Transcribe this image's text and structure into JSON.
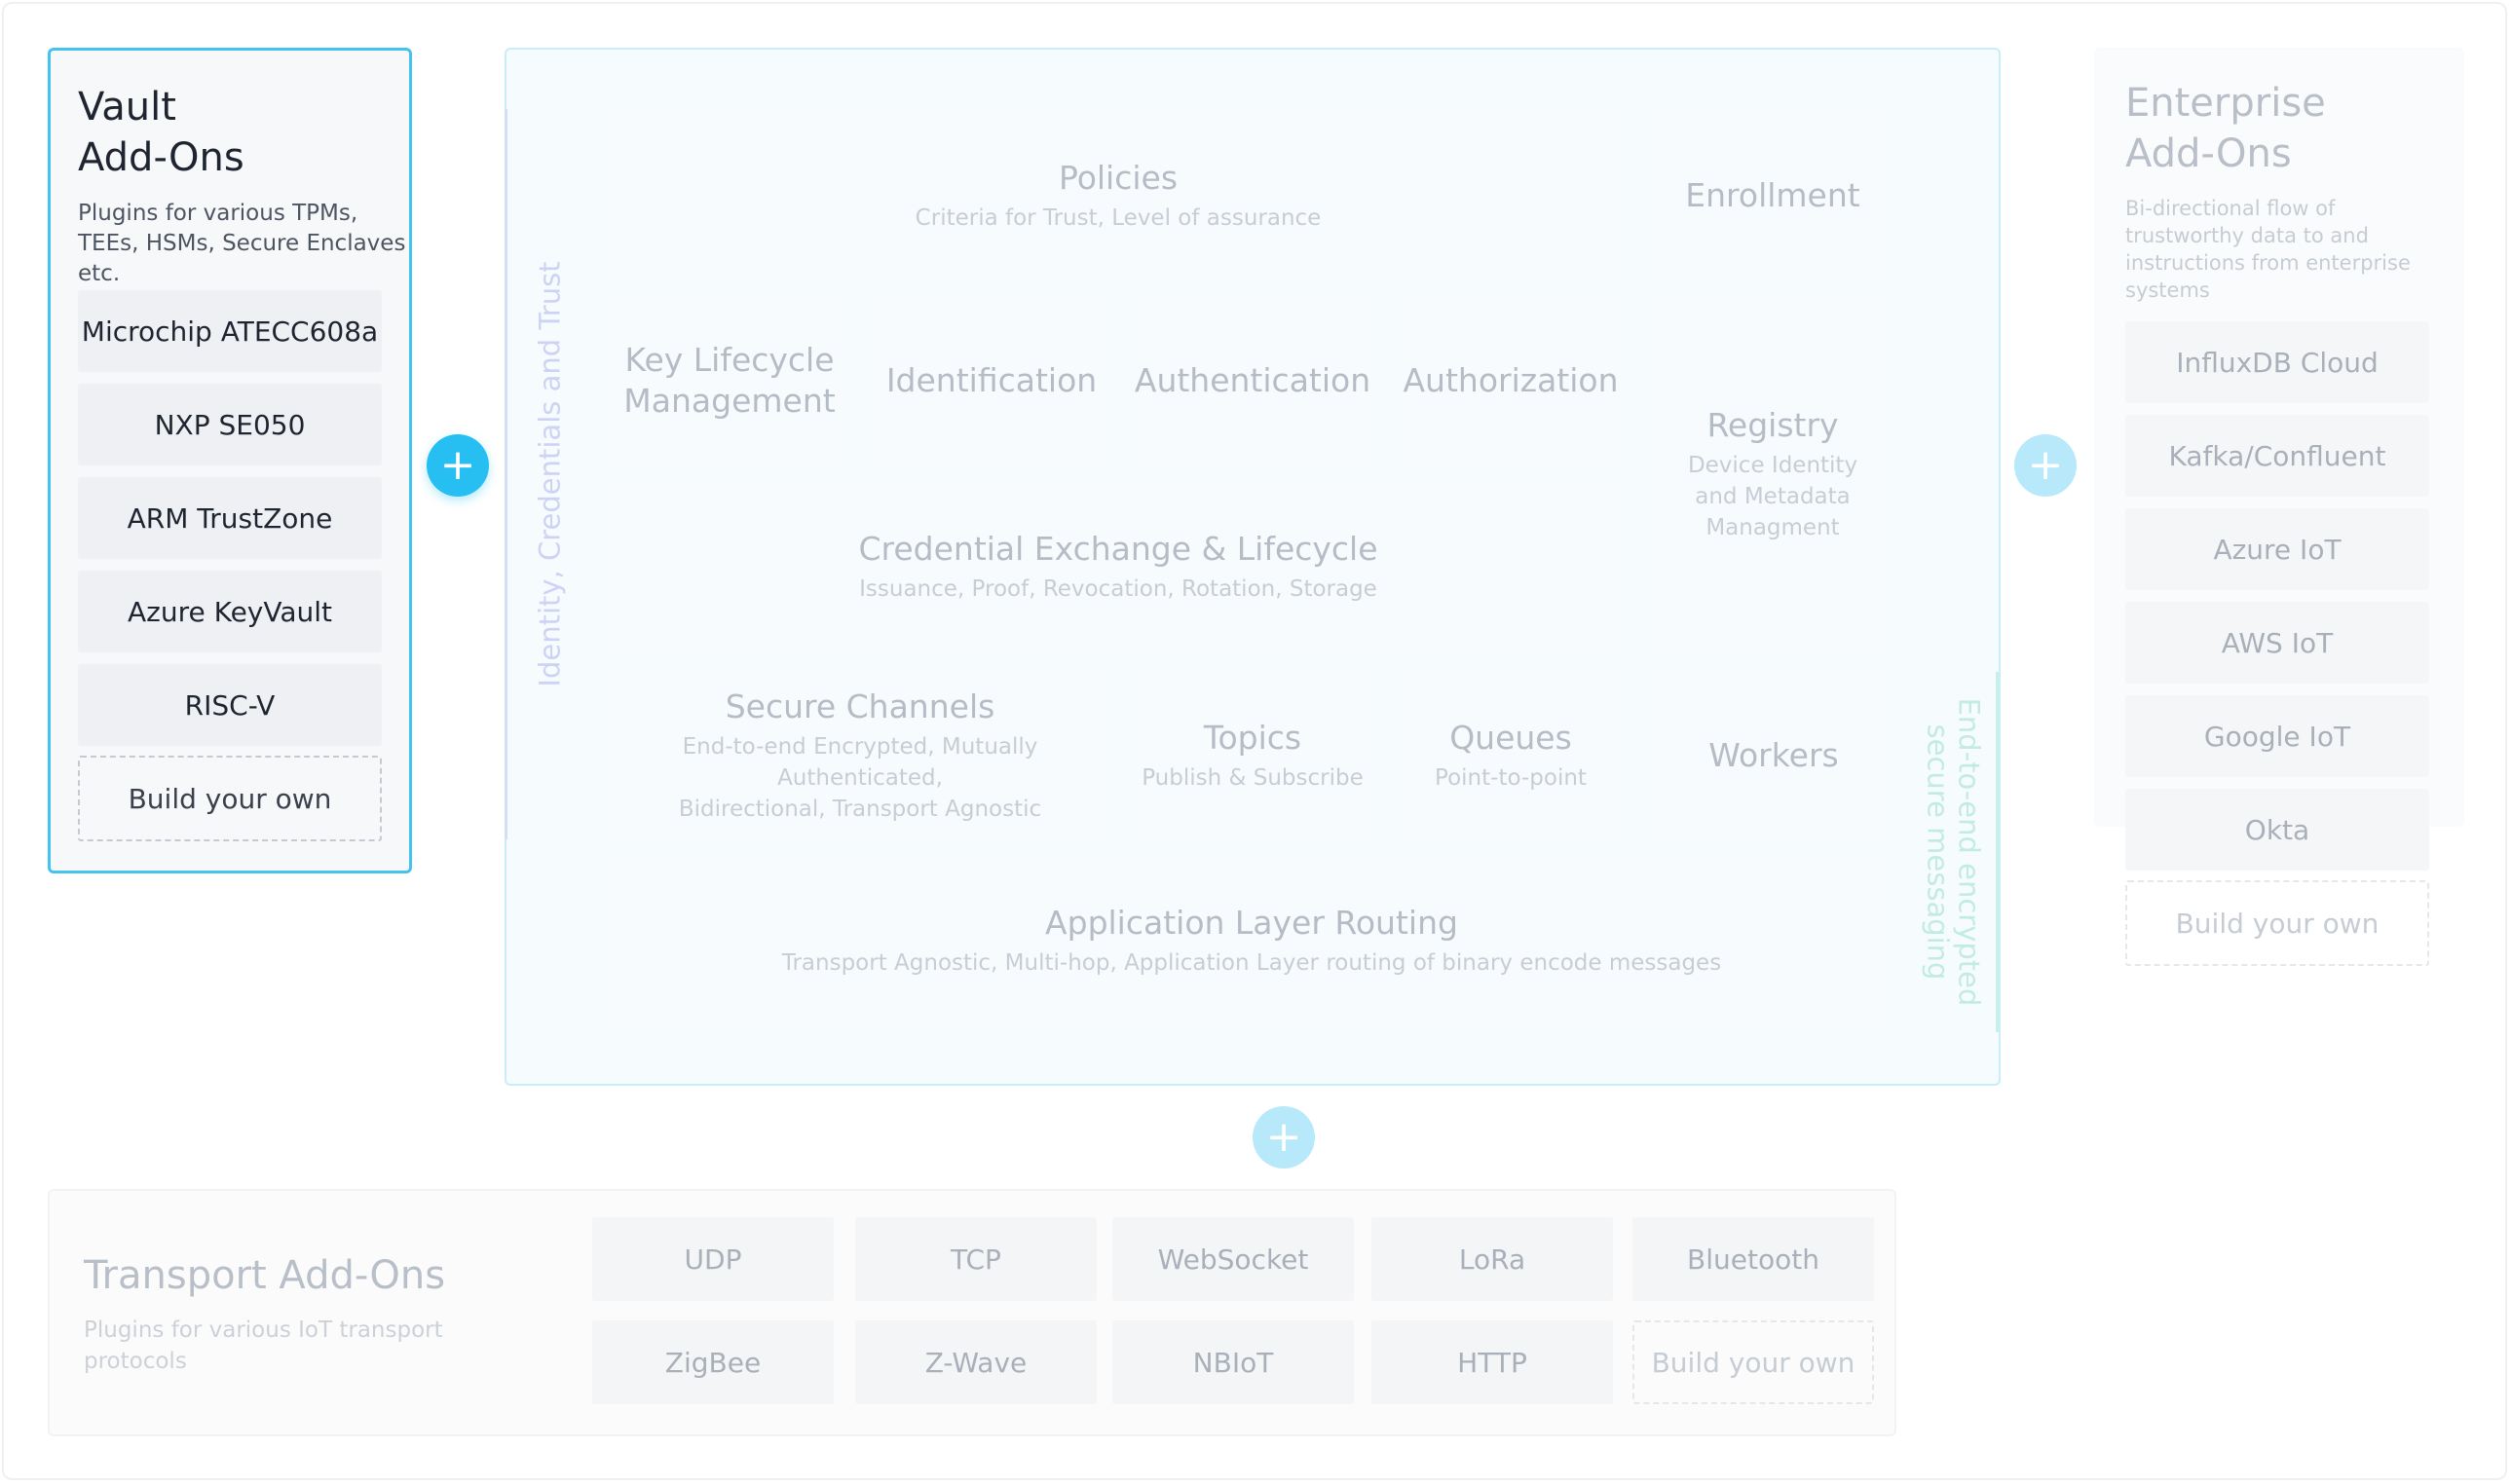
{
  "vault": {
    "title_line1": "Vault",
    "title_line2": "Add-Ons",
    "description": "Plugins for various TPMs, TEEs, HSMs, Secure Enclaves etc.",
    "items": [
      "Microchip ATECC608a",
      "NXP SE050",
      "ARM TrustZone",
      "Azure KeyVault",
      "RISC-V"
    ],
    "build_your_own": "Build your own"
  },
  "plus_symbol": "+",
  "core": {
    "side_label_left": "Identity, Credentials and Trust",
    "side_label_right_line1": "End-to-end encrypted",
    "side_label_right_line2": "secure messaging",
    "policies": {
      "title": "Policies",
      "subtitle": "Criteria for Trust, Level of assurance"
    },
    "enrollment": {
      "title": "Enrollment"
    },
    "key_lifecycle": {
      "title_line1": "Key Lifecycle",
      "title_line2": "Management"
    },
    "identification": {
      "title": "Identification"
    },
    "authentication": {
      "title": "Authentication"
    },
    "authorization": {
      "title": "Authorization"
    },
    "registry": {
      "title": "Registry",
      "sub_line1": "Device Identity",
      "sub_line2": "and Metadata",
      "sub_line3": "Managment"
    },
    "credential_exchange": {
      "title": "Credential Exchange & Lifecycle",
      "subtitle": "Issuance, Proof, Revocation, Rotation, Storage"
    },
    "secure_channels": {
      "title": "Secure Channels",
      "sub_line1": "End-to-end Encrypted, Mutually Authenticated,",
      "sub_line2": "Bidirectional, Transport Agnostic"
    },
    "topics": {
      "title": "Topics",
      "subtitle": "Publish & Subscribe"
    },
    "queues": {
      "title": "Queues",
      "subtitle": "Point-to-point"
    },
    "workers": {
      "title": "Workers"
    },
    "routing": {
      "title": "Application Layer Routing",
      "subtitle": "Transport Agnostic, Multi-hop, Application Layer routing of binary encode messages"
    }
  },
  "enterprise": {
    "title_line1": "Enterprise",
    "title_line2": "Add-Ons",
    "description": "Bi-directional flow of trustworthy data to and instructions from enterprise systems",
    "items": [
      "InfluxDB Cloud",
      "Kafka/Confluent",
      "Azure IoT",
      "AWS IoT",
      "Google IoT",
      "Okta"
    ],
    "build_your_own": "Build your own"
  },
  "transport": {
    "title": "Transport Add-Ons",
    "description": "Plugins for various IoT transport protocols",
    "row1": [
      "UDP",
      "TCP",
      "WebSocket",
      "LoRa",
      "Bluetooth"
    ],
    "row2": [
      "ZigBee",
      "Z-Wave",
      "NBIoT",
      "HTTP"
    ],
    "build_your_own": "Build your own"
  },
  "colors": {
    "accent": "#27bff2",
    "vault_border": "#45c3ef",
    "core_border": "#c9eefa",
    "core_background": "#f6fcfe"
  }
}
